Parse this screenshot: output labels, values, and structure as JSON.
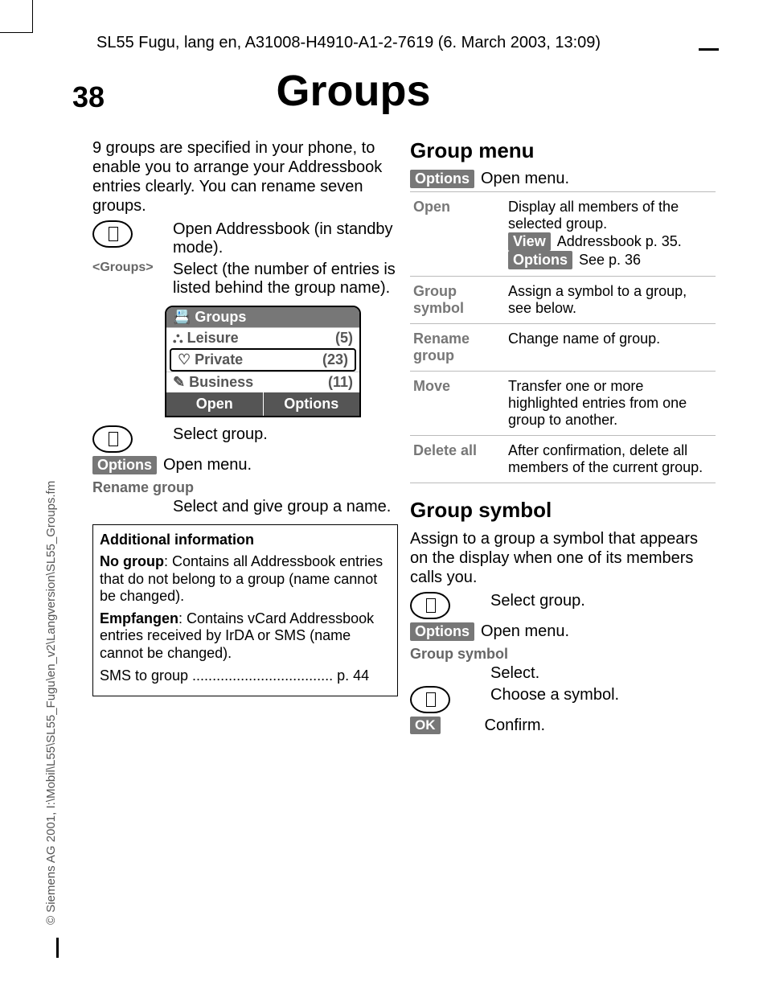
{
  "header_line": "SL55 Fugu, lang en, A31008-H4910-A1-2-7619 (6. March 2003, 13:09)",
  "page_number": "38",
  "title": "Groups",
  "side_text": "© Siemens AG 2001, I:\\Mobil\\L55\\SL55_Fugu\\en_v2\\Langversion\\SL55_Groups.fm",
  "left": {
    "intro": "9 groups are specified in your phone, to enable you to arrange your Addressbook entries clearly. You can rename seven groups.",
    "step1": "Open Addressbook (in standby mode).",
    "step2_key": "<Groups>",
    "step2_txt": "Select (the number of entries is listed behind the group name).",
    "screen": {
      "title": "Groups",
      "rows": [
        {
          "icon": "⛬",
          "label": "Leisure",
          "count": "(5)"
        },
        {
          "icon": "♡",
          "label": "Private",
          "count": "(23)"
        },
        {
          "icon": "✎",
          "label": "Business",
          "count": "(11)"
        }
      ],
      "soft_left": "Open",
      "soft_right": "Options"
    },
    "step3": "Select group.",
    "options_label": "Options",
    "options_txt": "Open menu.",
    "rename_label": "Rename group",
    "rename_txt": "Select and give group a name.",
    "info": {
      "hd": "Additional information",
      "p1_b": "No group",
      "p1": ": Contains all Addressbook entries that do not belong to a group (name cannot be changed).",
      "p2_b": "Empfangen",
      "p2": ": Contains vCard Addressbook entries received by IrDA or SMS (name cannot be changed).",
      "p3": "SMS to group ................................... p. 44"
    }
  },
  "right": {
    "h_menu": "Group menu",
    "open_menu": "Open menu.",
    "table": [
      {
        "k": "Open",
        "v": "Display all members of the selected group.",
        "sk1": "View",
        "sk1t": "Addressbook p. 35.",
        "sk2": "Options",
        "sk2t": "See p. 36"
      },
      {
        "k": "Group symbol",
        "v": "Assign a symbol to a group, see below."
      },
      {
        "k": "Rename group",
        "v": "Change name of group."
      },
      {
        "k": "Move",
        "v": "Transfer one or more highlighted entries from one group to another."
      },
      {
        "k": "Delete all",
        "v": "After confirmation, delete all members of the current group."
      }
    ],
    "h_sym": "Group symbol",
    "sym_intro": "Assign to a group a symbol that appears on the display when one of its members calls you.",
    "s1": "Select group.",
    "s2": "Open menu.",
    "s3_label": "Group symbol",
    "s3": "Select.",
    "s4": "Choose a symbol.",
    "ok": "OK",
    "s5": "Confirm."
  }
}
